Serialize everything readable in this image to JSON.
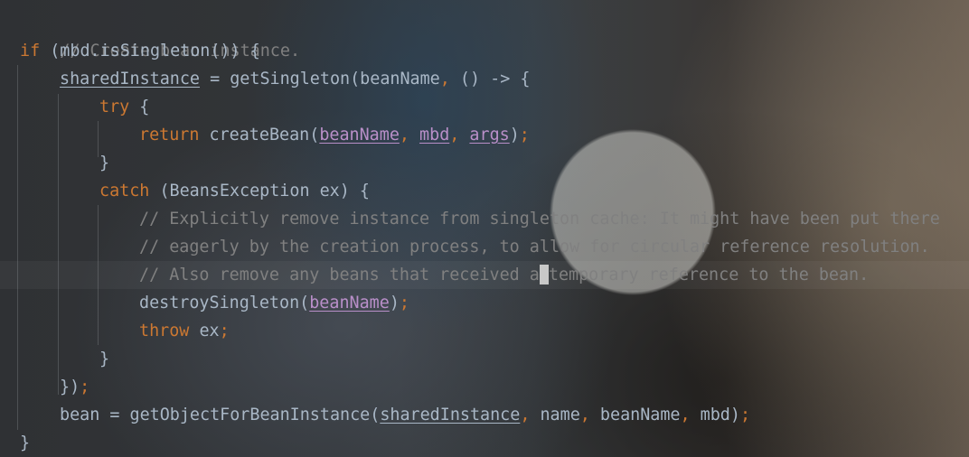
{
  "colors": {
    "keyword": "#cc7832",
    "comment": "#808080",
    "text": "#a9b7c6",
    "parameter": "#b98fc9",
    "current_line": "rgba(255,255,255,0.045)"
  },
  "code": {
    "line1": {
      "comment": "// Create bean instance."
    },
    "line2": {
      "kw_if": "if",
      "text": " (mbd.isSingleton()) {"
    },
    "line3": {
      "field": "sharedInstance",
      "text": " = getSingleton(beanName",
      "comma": ",",
      "text2": " () -> {"
    },
    "line4": {
      "kw_try": "try",
      "text": " {"
    },
    "line5": {
      "kw_return": "return",
      "text": " createBean(",
      "p1": "beanName",
      "c1": ", ",
      "p2": "mbd",
      "c2": ", ",
      "p3": "args",
      "close": ")",
      "semi": ";"
    },
    "line6": {
      "text": "}"
    },
    "line7": {
      "kw_catch": "catch",
      "text": " (BeansException ex) {"
    },
    "line8": {
      "comment": "// Explicitly remove instance from singleton cache: It might have been put there"
    },
    "line9": {
      "comment": "// eagerly by the creation process, to allow for circular reference resolution."
    },
    "line10": {
      "comment_a": "// Also remove any beans that received a",
      "comment_b": "temporary reference to the bean."
    },
    "line11": {
      "text": "destroySingleton(",
      "p1": "beanName",
      "close": ")",
      "semi": ";"
    },
    "line12": {
      "kw_throw": "throw",
      "text": " ex",
      "semi": ";"
    },
    "line13": {
      "text": "}"
    },
    "line14": {
      "text": "})",
      "semi": ";"
    },
    "line15": {
      "text": "bean = getObjectForBeanInstance(",
      "field": "sharedInstance",
      "c1": ",",
      "t2": " name",
      "c2": ",",
      "t3": " beanName",
      "c3": ",",
      "t4": " mbd)",
      "semi": ";"
    },
    "line16": {
      "text": "}"
    }
  }
}
